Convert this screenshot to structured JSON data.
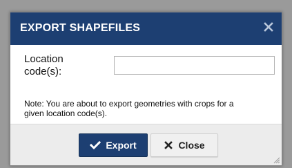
{
  "dialog": {
    "title": "EXPORT SHAPEFILES",
    "close_icon": "close-x-icon",
    "location_label_line1": "Location",
    "location_label_line2": "code(s):",
    "location_value": "",
    "note_line1": "Note: You are about to export geometries with crops for a",
    "note_line2": "given location code(s)."
  },
  "footer": {
    "export_label": "Export",
    "export_icon": "check-icon",
    "close_label": "Close",
    "close_icon": "x-icon"
  },
  "colors": {
    "titlebar": "#1d3f72",
    "export_button": "#1d3f72",
    "close_button": "#f0f0f0",
    "footer": "#ececec",
    "backdrop": "#9a9a9a"
  }
}
